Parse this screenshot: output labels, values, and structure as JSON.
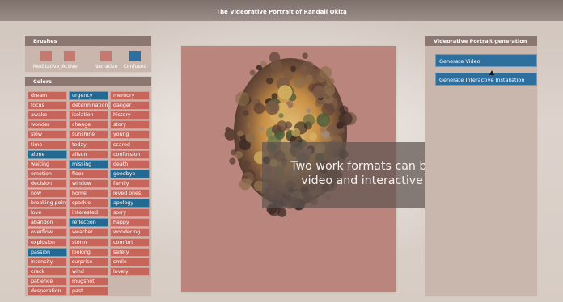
{
  "window": {
    "title": "The Videorative Portrait of Randall Okita"
  },
  "brushes": {
    "title": "Brushes",
    "items": [
      {
        "label": "Meditative",
        "color": "#c47a70"
      },
      {
        "label": "Active",
        "color": "#c47a70"
      },
      {
        "label": "Narrative",
        "color": "#c47a70"
      },
      {
        "label": "Confused",
        "color": "#2f6f9e"
      }
    ]
  },
  "colors": {
    "title": "Colors",
    "selected_color": "#226a94",
    "cell_color": "#c7655a",
    "col1": [
      "dream",
      "focus",
      "awake",
      "wonder",
      "slow",
      "time",
      "alone",
      "waiting",
      "emotion",
      "decision",
      "now",
      "breaking point",
      "love",
      "abandon",
      "overflow",
      "explosion",
      "passion",
      "intensity",
      "crack",
      "patience",
      "desperation"
    ],
    "col2": [
      "urgency",
      "determination",
      "isolation",
      "change",
      "sunshine",
      "today",
      "alison",
      "missing",
      "floor",
      "window",
      "home",
      "sparkle",
      "interested",
      "reflection",
      "weather",
      "storm",
      "looking",
      "surprise",
      "wind",
      "mugshot",
      "past"
    ],
    "col3": [
      "memory",
      "danger",
      "history",
      "story",
      "young",
      "scared",
      "confession",
      "death",
      "goodbye",
      "family",
      "loved ones",
      "apology",
      "sorry",
      "happy",
      "wondering",
      "comfort",
      "safety",
      "smile",
      "lovely"
    ]
  },
  "caption": {
    "line1": "Two work formats can be generated:",
    "line2": "video and interactive installation"
  },
  "generation": {
    "title": "Videorative Portrait generation",
    "buttons": [
      {
        "label": "Generate Video"
      },
      {
        "label": "Generate Interactive Installation"
      }
    ]
  }
}
